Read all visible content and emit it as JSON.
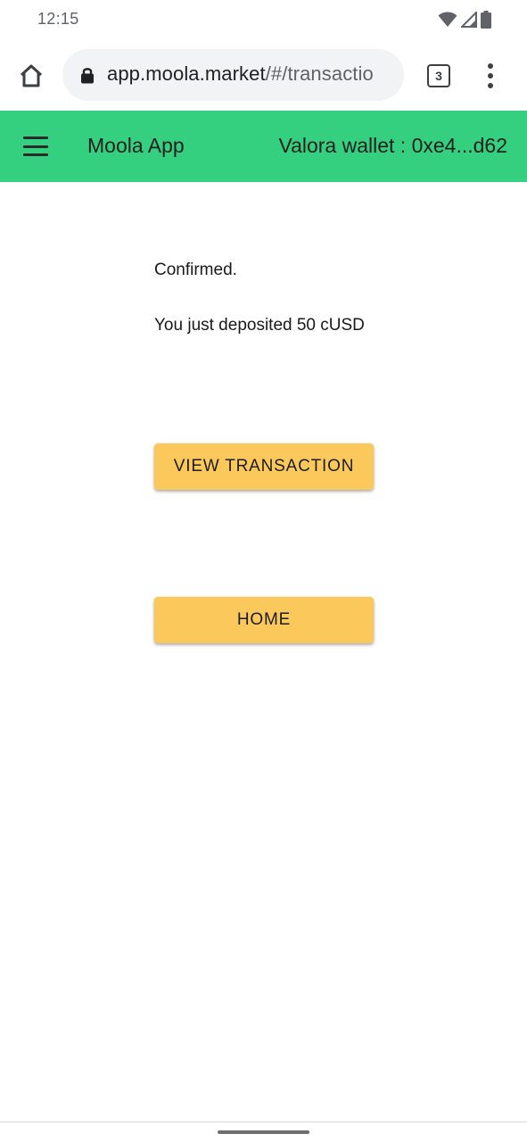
{
  "status_bar": {
    "time": "12:15",
    "icons": [
      "wifi-icon",
      "signal-icon",
      "battery-icon"
    ]
  },
  "browser": {
    "url_host": "app.moola.market",
    "url_path": "/#/transactio",
    "tab_count": "3",
    "icons": [
      "home-icon",
      "lock-icon",
      "tabs-icon",
      "more-vert-icon"
    ]
  },
  "app_header": {
    "title": "Moola App",
    "wallet_label": "Valora wallet : 0xe4...d62",
    "background_color": "#35d07f",
    "menu_icon": "hamburger-menu-icon"
  },
  "main": {
    "confirmed_text": "Confirmed.",
    "deposit_text": "You just deposited 50 cUSD",
    "view_transaction_label": "VIEW TRANSACTION",
    "home_label": "HOME",
    "button_color": "#fbc95b"
  }
}
